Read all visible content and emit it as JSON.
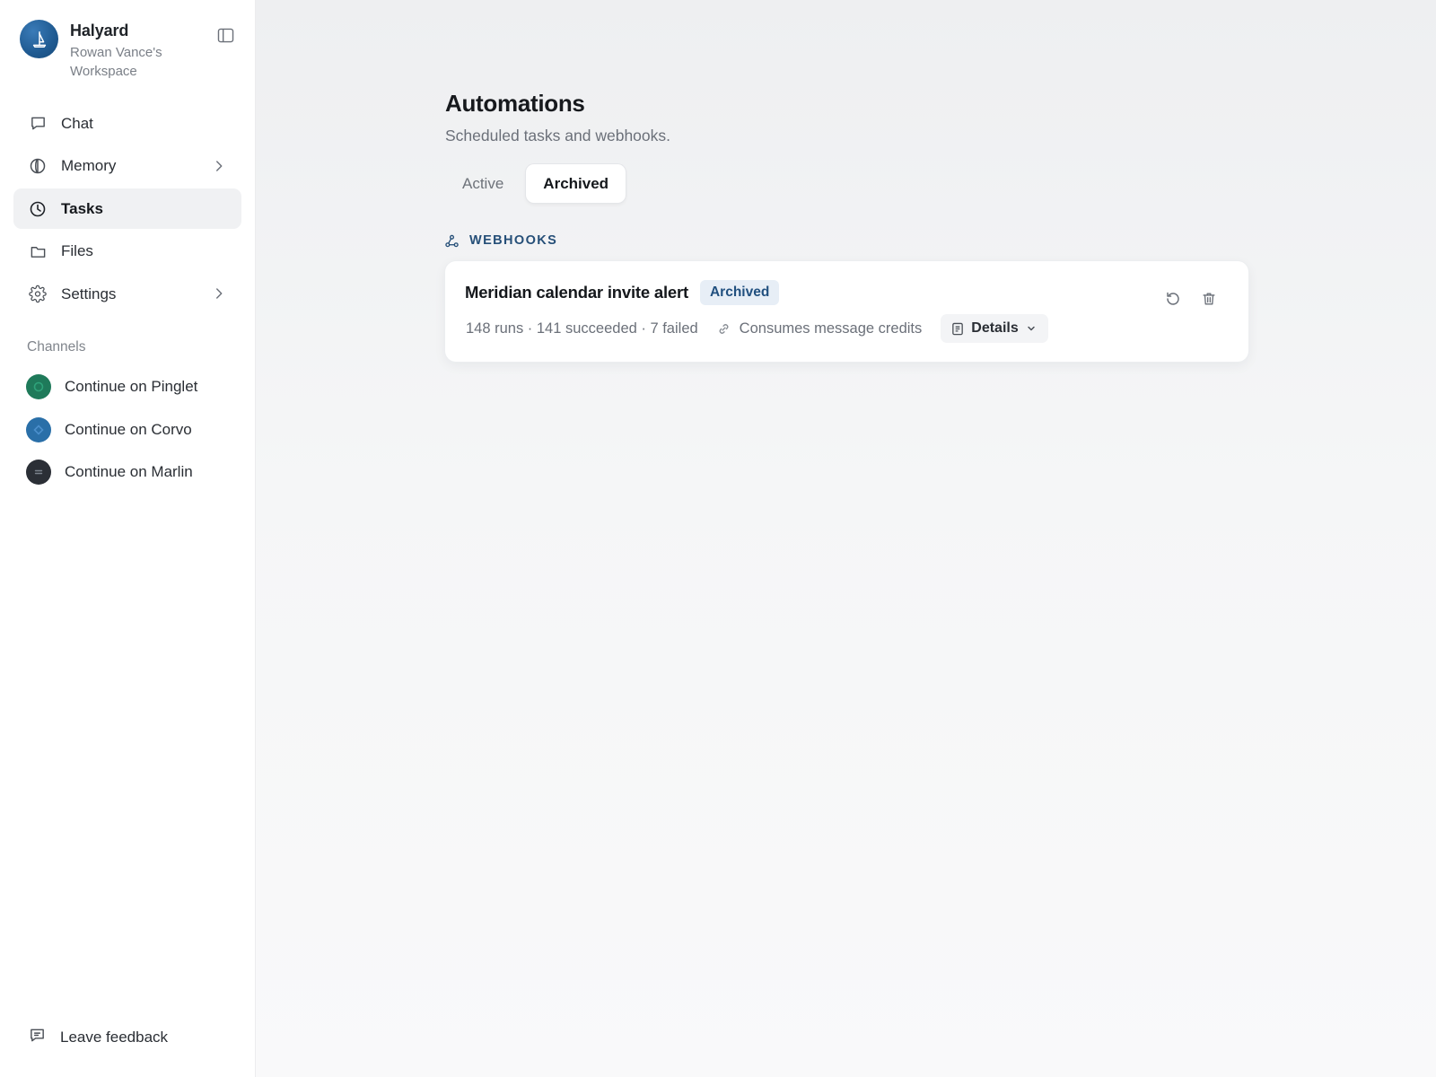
{
  "workspace": {
    "name": "Halyard",
    "subtitle": "Rowan Vance's Workspace"
  },
  "nav": {
    "chat": "Chat",
    "memory": "Memory",
    "tasks": "Tasks",
    "files": "Files",
    "settings": "Settings"
  },
  "channels": {
    "title": "Channels",
    "items": [
      {
        "label": "Continue on Pinglet",
        "color": "#1f7a5a"
      },
      {
        "label": "Continue on Corvo",
        "color": "#2a6fa8"
      },
      {
        "label": "Continue on Marlin",
        "color": "#2b2f36"
      }
    ]
  },
  "feedback": "Leave feedback",
  "page": {
    "title": "Automations",
    "subtitle": "Scheduled tasks and webhooks.",
    "tabs": [
      {
        "label": "Active"
      },
      {
        "label": "Archived"
      }
    ],
    "section": "WEBHOOKS",
    "card": {
      "title": "Meridian calendar invite alert",
      "badge": "Archived",
      "stats": "148 runs · 141 succeeded · 7 failed",
      "credits": "Consumes message credits",
      "details": "Details"
    }
  },
  "colors": {
    "accent": "#264f78",
    "badge_bg": "#e7eef6"
  }
}
